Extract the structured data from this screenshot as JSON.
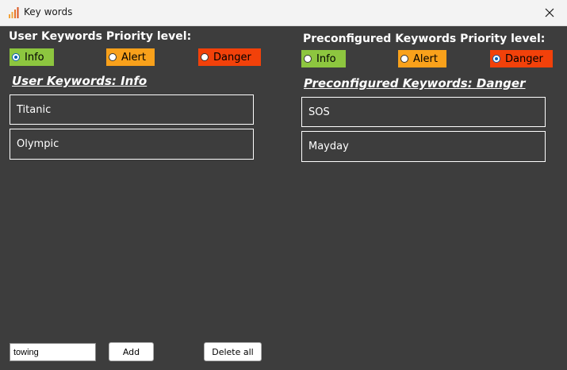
{
  "window": {
    "title": "Key words"
  },
  "user": {
    "priority_label": "User Keywords Priority level:",
    "options": [
      {
        "label": "Info",
        "color": "#8dc63f",
        "checked": true
      },
      {
        "label": "Alert",
        "color": "#f9a11b",
        "checked": false
      },
      {
        "label": "Danger",
        "color": "#f2410a",
        "checked": false
      }
    ],
    "heading": "User Keywords: Info",
    "keywords": [
      "Titanic",
      "Olympic"
    ]
  },
  "preconfigured": {
    "priority_label": "Preconfigured Keywords Priority level:",
    "options": [
      {
        "label": "Info",
        "color": "#8dc63f",
        "checked": false
      },
      {
        "label": "Alert",
        "color": "#f9a11b",
        "checked": false
      },
      {
        "label": "Danger",
        "color": "#f2410a",
        "checked": true
      }
    ],
    "heading": "Preconfigured Keywords: Danger",
    "keywords": [
      "SOS",
      "Mayday"
    ]
  },
  "footer": {
    "input_value": "towing",
    "add_label": "Add",
    "delete_all_label": "Delete all"
  },
  "icons": {
    "app": "bar-chart-icon",
    "close": "close-icon"
  }
}
